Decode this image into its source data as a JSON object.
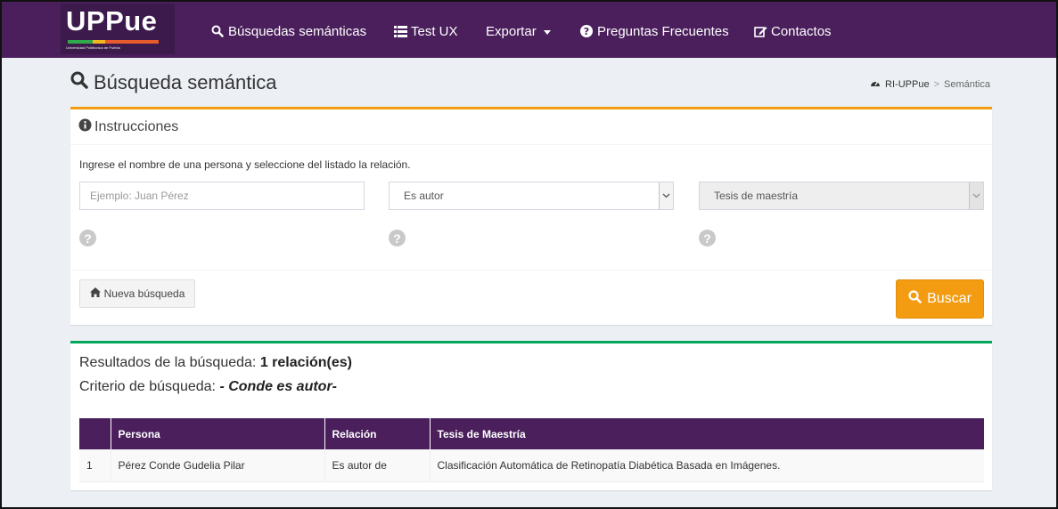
{
  "brand": {
    "name": "UPPue",
    "subtitle": "Universidad Politécnica de Puebla",
    "stripe_colors": [
      "#2eaa4a",
      "#f1b820",
      "#e85b2c"
    ]
  },
  "nav": {
    "items": [
      {
        "label": "Búsquedas semánticas",
        "icon": "search-icon"
      },
      {
        "label": "Test UX",
        "icon": "list-icon"
      },
      {
        "label": "Exportar",
        "icon": "",
        "dropdown": true
      },
      {
        "label": "Preguntas Frecuentes",
        "icon": "question-circle-icon"
      },
      {
        "label": "Contactos",
        "icon": "edit-icon"
      }
    ]
  },
  "page": {
    "title": "Búsqueda semántica",
    "breadcrumb": [
      "RI-UPPue",
      "Semántica"
    ]
  },
  "instructions": {
    "title": "Instrucciones",
    "help": "Ingrese el nombre de una persona y seleccione del listado la relación.",
    "person_input": {
      "value": "",
      "placeholder": "Ejemplo: Juan Pérez"
    },
    "relation_select": {
      "value": "Es autor"
    },
    "type_select": {
      "value": "Tesis de maestría",
      "disabled": true
    },
    "new_search_label": "Nueva búsqueda",
    "search_label": "Buscar"
  },
  "results": {
    "summary_label": "Resultados de la búsqueda:",
    "summary_value": "1 relación(es)",
    "criteria_label": "Criterio de búsqueda:",
    "criteria_value": "- Conde es autor-",
    "columns": [
      "",
      "Persona",
      "Relación",
      "Tesis de Maestría"
    ],
    "rows": [
      [
        "1",
        "Pérez Conde Gudelia Pilar",
        "Es autor de",
        "Clasificación Automática de Retinopatía Diabética Basada en Imágenes."
      ]
    ]
  },
  "colors": {
    "navbar": "#4a1f5c",
    "warning": "#f39c12",
    "success": "#00a65a",
    "background": "#ecf0f5"
  }
}
